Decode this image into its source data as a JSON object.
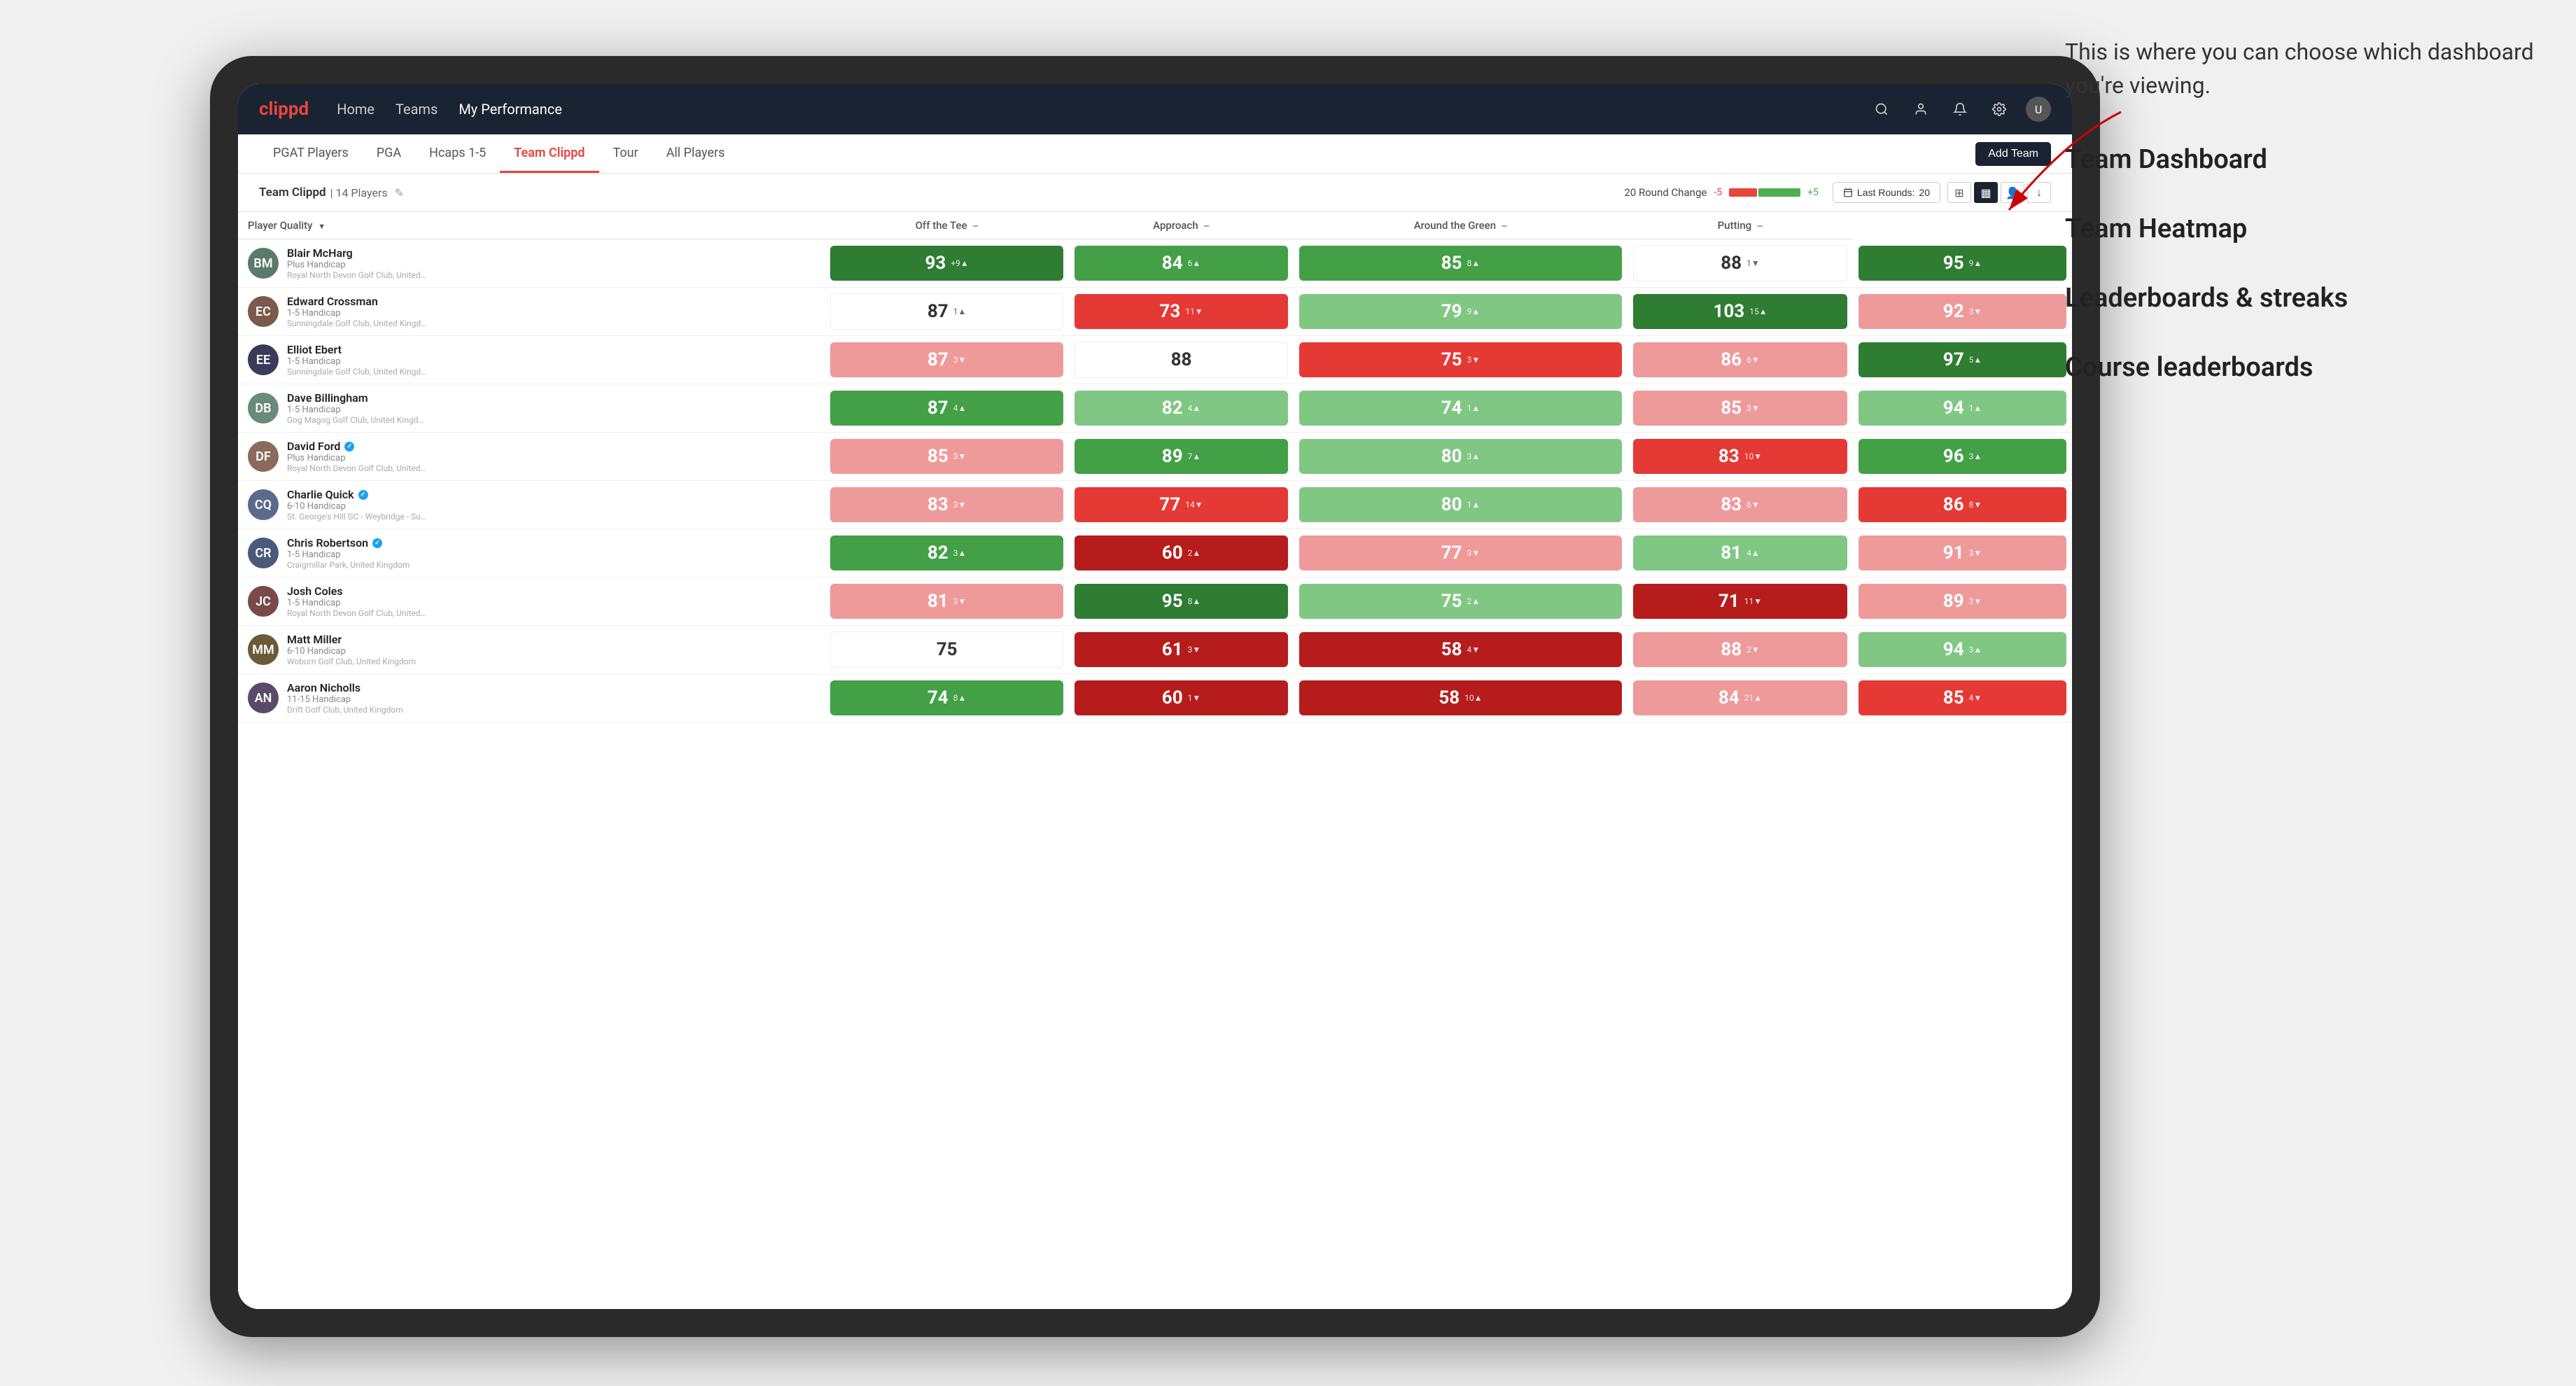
{
  "annotation": {
    "callout": "This is where you can choose which dashboard you're viewing.",
    "items": [
      "Team Dashboard",
      "Team Heatmap",
      "Leaderboards & streaks",
      "Course leaderboards"
    ]
  },
  "nav": {
    "logo": "clippd",
    "links": [
      "Home",
      "Teams",
      "My Performance"
    ],
    "active_link": "My Performance"
  },
  "tabs": {
    "items": [
      "PGAT Players",
      "PGA",
      "Hcaps 1-5",
      "Team Clippd",
      "Tour",
      "All Players"
    ],
    "active": "Team Clippd",
    "add_button": "Add Team"
  },
  "team_header": {
    "name": "Team Clippd",
    "separator": "|",
    "count": "14 Players",
    "round_change_label": "20 Round Change",
    "change_neg": "-5",
    "change_pos": "+5",
    "last_rounds_label": "Last Rounds:",
    "last_rounds_value": "20"
  },
  "table": {
    "columns": {
      "player": "Player Quality",
      "off_tee": "Off the Tee",
      "approach": "Approach",
      "around_green": "Around the Green",
      "putting": "Putting"
    },
    "players": [
      {
        "name": "Blair McHarg",
        "handicap": "Plus Handicap",
        "club": "Royal North Devon Golf Club, United Kingdom",
        "avatar_color": "#5a7a6a",
        "avatar_initials": "BM",
        "verified": false,
        "player_quality": {
          "value": 93,
          "change": "+9",
          "direction": "up",
          "bg": "green-strong"
        },
        "off_tee": {
          "value": 84,
          "change": "6",
          "direction": "up",
          "bg": "green-medium"
        },
        "approach": {
          "value": 85,
          "change": "8",
          "direction": "up",
          "bg": "green-medium"
        },
        "around_green": {
          "value": 88,
          "change": "1",
          "direction": "down",
          "bg": "white"
        },
        "putting": {
          "value": 95,
          "change": "9",
          "direction": "up",
          "bg": "green-strong"
        }
      },
      {
        "name": "Edward Crossman",
        "handicap": "1-5 Handicap",
        "club": "Sunningdale Golf Club, United Kingdom",
        "avatar_color": "#7a5a4a",
        "avatar_initials": "EC",
        "verified": false,
        "player_quality": {
          "value": 87,
          "change": "1",
          "direction": "up",
          "bg": "white"
        },
        "off_tee": {
          "value": 73,
          "change": "11",
          "direction": "down",
          "bg": "red-medium"
        },
        "approach": {
          "value": 79,
          "change": "9",
          "direction": "up",
          "bg": "green-light"
        },
        "around_green": {
          "value": 103,
          "change": "15",
          "direction": "up",
          "bg": "green-strong"
        },
        "putting": {
          "value": 92,
          "change": "3",
          "direction": "down",
          "bg": "red-light"
        }
      },
      {
        "name": "Elliot Ebert",
        "handicap": "1-5 Handicap",
        "club": "Sunningdale Golf Club, United Kingdom",
        "avatar_color": "#3a3a5a",
        "avatar_initials": "EE",
        "verified": false,
        "player_quality": {
          "value": 87,
          "change": "3",
          "direction": "down",
          "bg": "red-light"
        },
        "off_tee": {
          "value": 88,
          "change": "",
          "direction": "none",
          "bg": "white"
        },
        "approach": {
          "value": 75,
          "change": "3",
          "direction": "down",
          "bg": "red-medium"
        },
        "around_green": {
          "value": 86,
          "change": "6",
          "direction": "down",
          "bg": "red-light"
        },
        "putting": {
          "value": 97,
          "change": "5",
          "direction": "up",
          "bg": "green-strong"
        }
      },
      {
        "name": "Dave Billingham",
        "handicap": "1-5 Handicap",
        "club": "Gog Magog Golf Club, United Kingdom",
        "avatar_color": "#6a8a7a",
        "avatar_initials": "DB",
        "verified": false,
        "player_quality": {
          "value": 87,
          "change": "4",
          "direction": "up",
          "bg": "green-medium"
        },
        "off_tee": {
          "value": 82,
          "change": "4",
          "direction": "up",
          "bg": "green-light"
        },
        "approach": {
          "value": 74,
          "change": "1",
          "direction": "up",
          "bg": "green-light"
        },
        "around_green": {
          "value": 85,
          "change": "3",
          "direction": "down",
          "bg": "red-light"
        },
        "putting": {
          "value": 94,
          "change": "1",
          "direction": "up",
          "bg": "green-light"
        }
      },
      {
        "name": "David Ford",
        "handicap": "Plus Handicap",
        "club": "Royal North Devon Golf Club, United Kingdom",
        "avatar_color": "#8a6a5a",
        "avatar_initials": "DF",
        "verified": true,
        "player_quality": {
          "value": 85,
          "change": "3",
          "direction": "down",
          "bg": "red-light"
        },
        "off_tee": {
          "value": 89,
          "change": "7",
          "direction": "up",
          "bg": "green-medium"
        },
        "approach": {
          "value": 80,
          "change": "3",
          "direction": "up",
          "bg": "green-light"
        },
        "around_green": {
          "value": 83,
          "change": "10",
          "direction": "down",
          "bg": "red-medium"
        },
        "putting": {
          "value": 96,
          "change": "3",
          "direction": "up",
          "bg": "green-medium"
        }
      },
      {
        "name": "Charlie Quick",
        "handicap": "6-10 Handicap",
        "club": "St. George's Hill GC - Weybridge - Surrey, Uni...",
        "avatar_color": "#5a6a8a",
        "avatar_initials": "CQ",
        "verified": true,
        "player_quality": {
          "value": 83,
          "change": "3",
          "direction": "down",
          "bg": "red-light"
        },
        "off_tee": {
          "value": 77,
          "change": "14",
          "direction": "down",
          "bg": "red-medium"
        },
        "approach": {
          "value": 80,
          "change": "1",
          "direction": "up",
          "bg": "green-light"
        },
        "around_green": {
          "value": 83,
          "change": "6",
          "direction": "down",
          "bg": "red-light"
        },
        "putting": {
          "value": 86,
          "change": "8",
          "direction": "down",
          "bg": "red-medium"
        }
      },
      {
        "name": "Chris Robertson",
        "handicap": "1-5 Handicap",
        "club": "Craigmillar Park, United Kingdom",
        "avatar_color": "#4a5a7a",
        "avatar_initials": "CR",
        "verified": true,
        "player_quality": {
          "value": 82,
          "change": "3",
          "direction": "up",
          "bg": "green-medium"
        },
        "off_tee": {
          "value": 60,
          "change": "2",
          "direction": "up",
          "bg": "red-strong"
        },
        "approach": {
          "value": 77,
          "change": "3",
          "direction": "down",
          "bg": "red-light"
        },
        "around_green": {
          "value": 81,
          "change": "4",
          "direction": "up",
          "bg": "green-light"
        },
        "putting": {
          "value": 91,
          "change": "3",
          "direction": "down",
          "bg": "red-light"
        }
      },
      {
        "name": "Josh Coles",
        "handicap": "1-5 Handicap",
        "club": "Royal North Devon Golf Club, United Kingdom",
        "avatar_color": "#7a4a4a",
        "avatar_initials": "JC",
        "verified": false,
        "player_quality": {
          "value": 81,
          "change": "3",
          "direction": "down",
          "bg": "red-light"
        },
        "off_tee": {
          "value": 95,
          "change": "8",
          "direction": "up",
          "bg": "green-strong"
        },
        "approach": {
          "value": 75,
          "change": "2",
          "direction": "up",
          "bg": "green-light"
        },
        "around_green": {
          "value": 71,
          "change": "11",
          "direction": "down",
          "bg": "red-strong"
        },
        "putting": {
          "value": 89,
          "change": "2",
          "direction": "down",
          "bg": "red-light"
        }
      },
      {
        "name": "Matt Miller",
        "handicap": "6-10 Handicap",
        "club": "Woburn Golf Club, United Kingdom",
        "avatar_color": "#6a5a3a",
        "avatar_initials": "MM",
        "verified": false,
        "player_quality": {
          "value": 75,
          "change": "",
          "direction": "none",
          "bg": "white"
        },
        "off_tee": {
          "value": 61,
          "change": "3",
          "direction": "down",
          "bg": "red-strong"
        },
        "approach": {
          "value": 58,
          "change": "4",
          "direction": "down",
          "bg": "red-strong"
        },
        "around_green": {
          "value": 88,
          "change": "2",
          "direction": "down",
          "bg": "red-light"
        },
        "putting": {
          "value": 94,
          "change": "3",
          "direction": "up",
          "bg": "green-light"
        }
      },
      {
        "name": "Aaron Nicholls",
        "handicap": "11-15 Handicap",
        "club": "Drift Golf Club, United Kingdom",
        "avatar_color": "#5a4a6a",
        "avatar_initials": "AN",
        "verified": false,
        "player_quality": {
          "value": 74,
          "change": "8",
          "direction": "up",
          "bg": "green-medium"
        },
        "off_tee": {
          "value": 60,
          "change": "1",
          "direction": "down",
          "bg": "red-strong"
        },
        "approach": {
          "value": 58,
          "change": "10",
          "direction": "up",
          "bg": "red-strong"
        },
        "around_green": {
          "value": 84,
          "change": "21",
          "direction": "up",
          "bg": "red-light"
        },
        "putting": {
          "value": 85,
          "change": "4",
          "direction": "down",
          "bg": "red-medium"
        }
      }
    ]
  }
}
